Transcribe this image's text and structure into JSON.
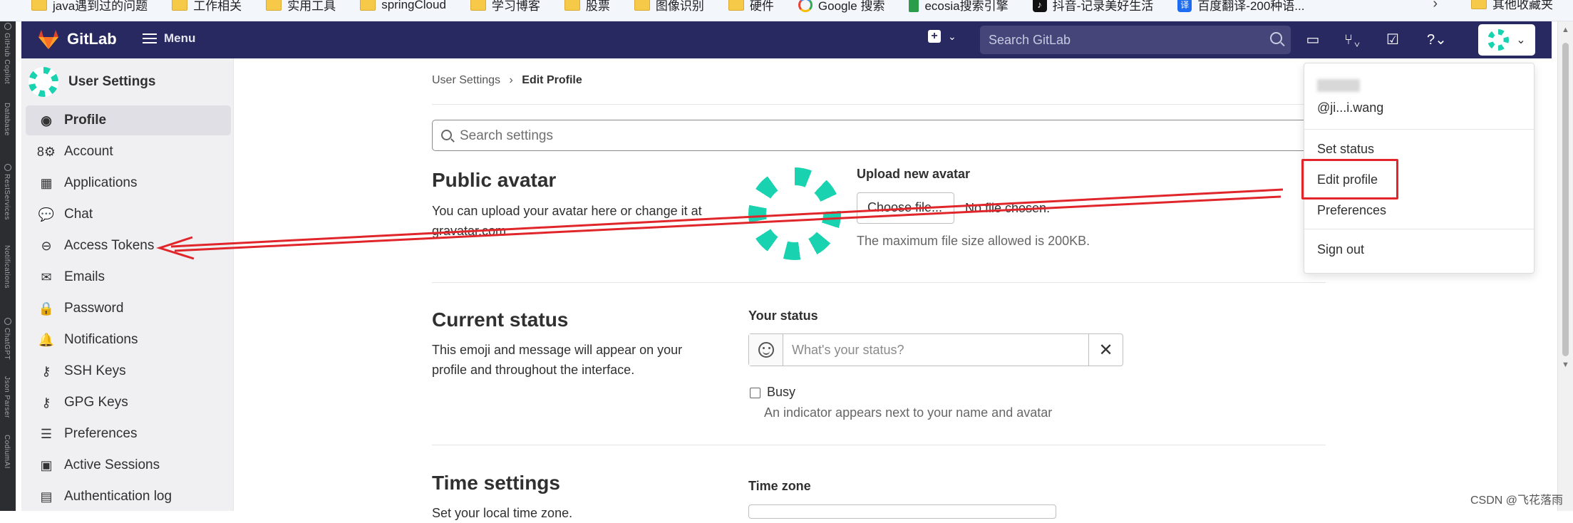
{
  "bookmarks": [
    {
      "label": "java遇到过的问题",
      "icon": "folder-icon"
    },
    {
      "label": "工作相关",
      "icon": "folder-icon"
    },
    {
      "label": "实用工具",
      "icon": "folder-icon"
    },
    {
      "label": "springCloud",
      "icon": "folder-icon"
    },
    {
      "label": "学习博客",
      "icon": "folder-icon"
    },
    {
      "label": "股票",
      "icon": "folder-icon"
    },
    {
      "label": "图像识别",
      "icon": "folder-icon"
    },
    {
      "label": "硬件",
      "icon": "folder-icon"
    },
    {
      "label": "Google 搜索",
      "icon": "google-icon"
    },
    {
      "label": "ecosia搜索引擎",
      "icon": "ecosia-icon"
    },
    {
      "label": "抖音-记录美好生活",
      "icon": "tiktok-icon"
    },
    {
      "label": "百度翻译-200种语...",
      "icon": "translate-icon"
    }
  ],
  "bookmarks_overflow": "其他收藏夹",
  "ide_strip": [
    "GitHub Copilot",
    "Database",
    "RestServices",
    "Notifications",
    "ChatGPT",
    "Json Parser",
    "CodiumAI"
  ],
  "topnav": {
    "brand": "GitLab",
    "menu_label": "Menu",
    "search_placeholder": "Search GitLab",
    "bg_color": "#292961"
  },
  "sidebar": {
    "title": "User Settings",
    "items": [
      {
        "label": "Profile",
        "icon": "profile-icon",
        "active": true
      },
      {
        "label": "Account",
        "icon": "account-icon"
      },
      {
        "label": "Applications",
        "icon": "applications-icon"
      },
      {
        "label": "Chat",
        "icon": "chat-icon"
      },
      {
        "label": "Access Tokens",
        "icon": "token-icon"
      },
      {
        "label": "Emails",
        "icon": "mail-icon"
      },
      {
        "label": "Password",
        "icon": "lock-icon"
      },
      {
        "label": "Notifications",
        "icon": "bell-icon"
      },
      {
        "label": "SSH Keys",
        "icon": "key-icon"
      },
      {
        "label": "GPG Keys",
        "icon": "key-icon"
      },
      {
        "label": "Preferences",
        "icon": "preferences-icon"
      },
      {
        "label": "Active Sessions",
        "icon": "monitor-icon"
      },
      {
        "label": "Authentication log",
        "icon": "log-icon"
      }
    ]
  },
  "breadcrumb": {
    "parent": "User Settings",
    "separator": "›",
    "current": "Edit Profile"
  },
  "search_settings": {
    "placeholder": "Search settings"
  },
  "public_avatar": {
    "title": "Public avatar",
    "description_line1": "You can upload your avatar here or change it at",
    "description_line2": "gravatar.com",
    "upload_label": "Upload new avatar",
    "choose_button": "Choose file...",
    "no_file": "No file chosen.",
    "max_size": "The maximum file size allowed is 200KB."
  },
  "current_status": {
    "title": "Current status",
    "description_line1": "This emoji and message will appear on your",
    "description_line2": "profile and throughout the interface.",
    "your_status_label": "Your status",
    "status_placeholder": "What's your status?",
    "clear_symbol": "✕",
    "busy_label": "Busy",
    "busy_help": "An indicator appears next to your name and avatar"
  },
  "time_settings": {
    "title": "Time settings",
    "description_partial": "Set your local time zone.",
    "time_zone_label": "Time zone"
  },
  "user_dropdown": {
    "username": "@ji...i.wang",
    "items": [
      "Set status",
      "Edit profile",
      "Preferences",
      "Sign out"
    ]
  },
  "watermark": "CSDN @飞花落雨",
  "colors": {
    "accent": "#292961",
    "annotation_red": "#e0262b",
    "avatar_teal": "#19d3b0"
  }
}
